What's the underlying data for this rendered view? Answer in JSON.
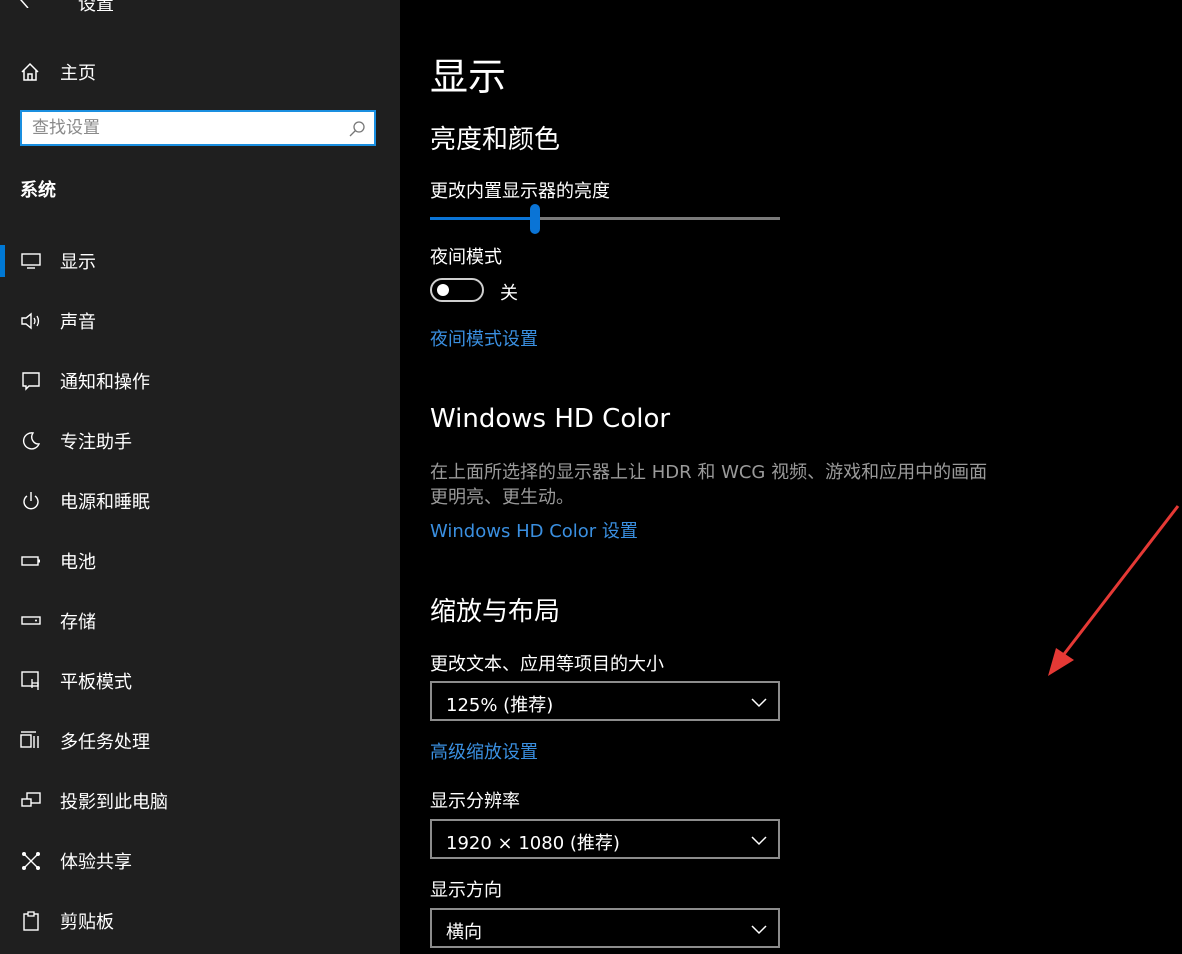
{
  "app": {
    "title": "设置"
  },
  "sidebar": {
    "home_label": "主页",
    "search_placeholder": "查找设置",
    "section_label": "系统",
    "items": [
      {
        "label": "显示",
        "icon": "monitor-icon",
        "selected": true
      },
      {
        "label": "声音",
        "icon": "speaker-icon"
      },
      {
        "label": "通知和操作",
        "icon": "notification-icon"
      },
      {
        "label": "专注助手",
        "icon": "moon-icon"
      },
      {
        "label": "电源和睡眠",
        "icon": "power-icon"
      },
      {
        "label": "电池",
        "icon": "battery-icon"
      },
      {
        "label": "存储",
        "icon": "storage-icon"
      },
      {
        "label": "平板模式",
        "icon": "tablet-icon"
      },
      {
        "label": "多任务处理",
        "icon": "multitask-icon"
      },
      {
        "label": "投影到此电脑",
        "icon": "project-icon"
      },
      {
        "label": "体验共享",
        "icon": "share-icon"
      },
      {
        "label": "剪贴板",
        "icon": "clipboard-icon"
      }
    ]
  },
  "main": {
    "page_title": "显示",
    "brightness": {
      "heading": "亮度和颜色",
      "slider_label": "更改内置显示器的亮度",
      "slider_value": 0.3,
      "night_light_label": "夜间模式",
      "night_light_state": "关",
      "night_light_link": "夜间模式设置"
    },
    "hdr": {
      "heading": "Windows HD Color",
      "description": "在上面所选择的显示器上让 HDR 和 WCG 视频、游戏和应用中的画面更明亮、更生动。",
      "link": "Windows HD Color 设置"
    },
    "scale": {
      "heading": "缩放与布局",
      "size_label": "更改文本、应用等项目的大小",
      "size_value": "125% (推荐)",
      "advanced_link": "高级缩放设置",
      "resolution_label": "显示分辨率",
      "resolution_value": "1920 × 1080 (推荐)",
      "orientation_label": "显示方向",
      "orientation_value": "横向"
    }
  },
  "colors": {
    "accent": "#0078d4",
    "link": "#3a8fe0",
    "annotation": "#e53935"
  }
}
